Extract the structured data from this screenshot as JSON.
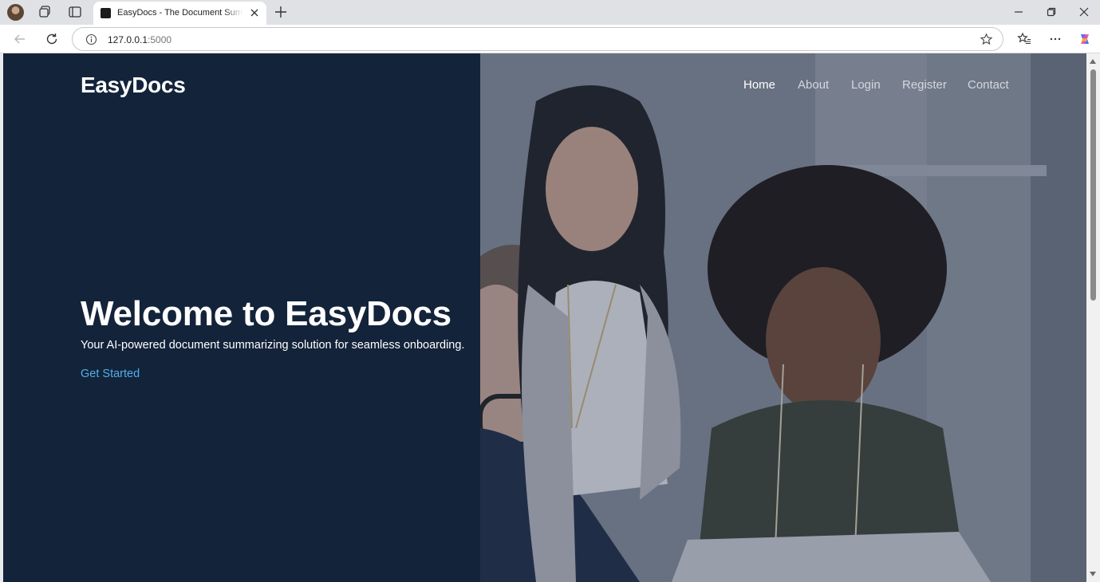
{
  "browser": {
    "tab_title": "EasyDocs - The Document Summarizer",
    "url_host": "127.0.0.1",
    "url_port": ":5000"
  },
  "site": {
    "brand": "EasyDocs",
    "nav": [
      {
        "label": "Home",
        "active": true
      },
      {
        "label": "About",
        "active": false
      },
      {
        "label": "Login",
        "active": false
      },
      {
        "label": "Register",
        "active": false
      },
      {
        "label": "Contact",
        "active": false
      }
    ],
    "hero": {
      "title": "Welcome to EasyDocs",
      "subtitle": "Your AI-powered document summarizing solution for seamless onboarding.",
      "cta": "Get Started"
    }
  },
  "colors": {
    "hero_bg": "#13233a",
    "cta": "#4fb0e8"
  }
}
